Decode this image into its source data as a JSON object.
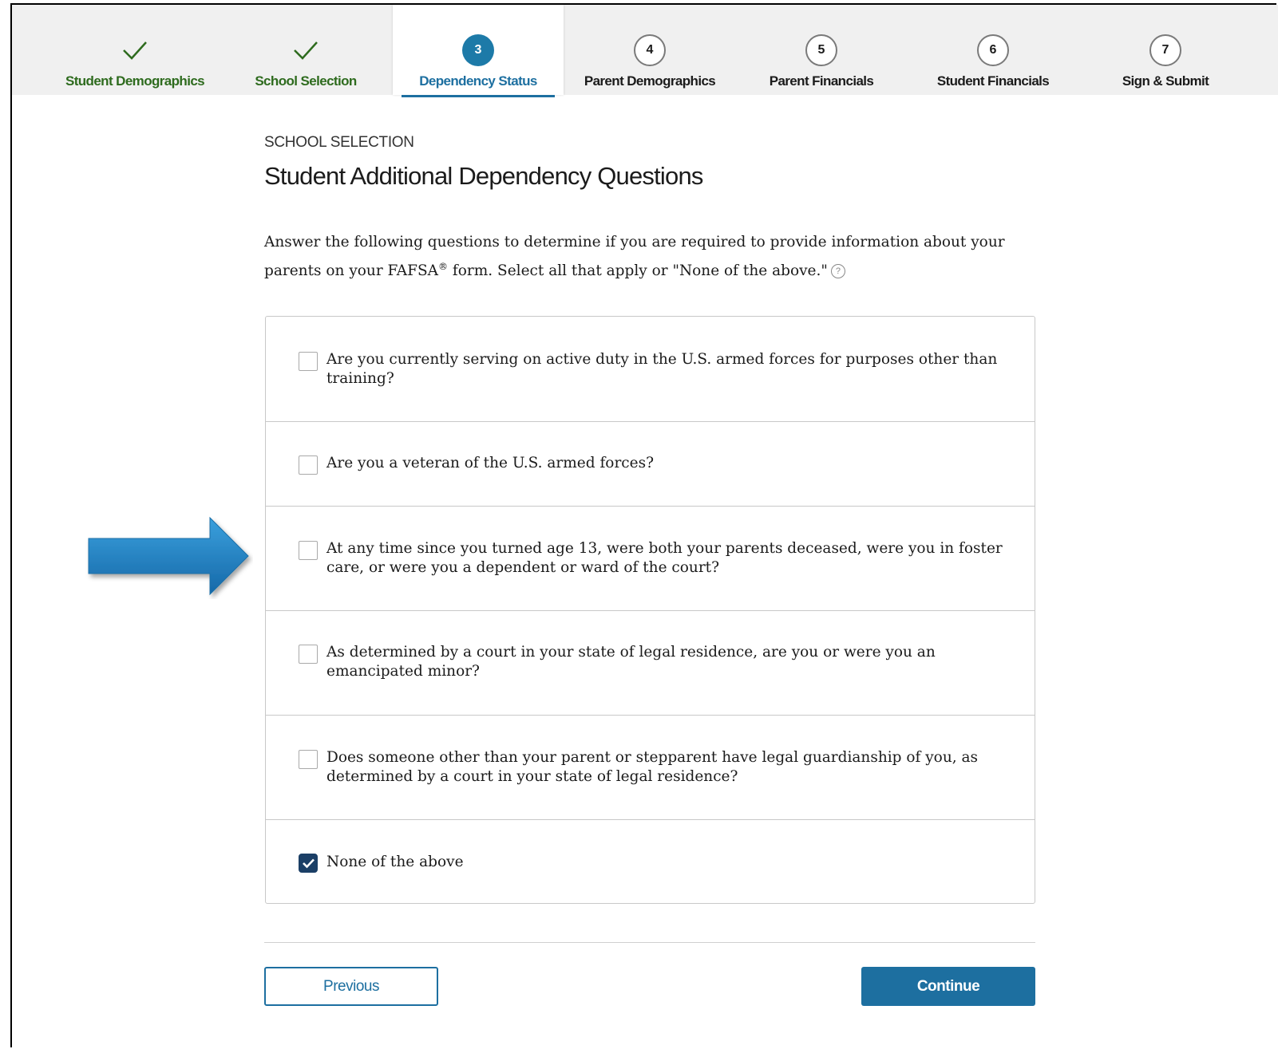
{
  "stepper": {
    "steps": [
      {
        "label": "Student Demographics",
        "status": "complete",
        "icon": "checkmark-icon"
      },
      {
        "label": "School Selection",
        "status": "complete",
        "icon": "checkmark-icon"
      },
      {
        "label": "Dependency Status",
        "status": "current",
        "number": "3"
      },
      {
        "label": "Parent Demographics",
        "status": "upcoming",
        "number": "4"
      },
      {
        "label": "Parent Financials",
        "status": "upcoming",
        "number": "5"
      },
      {
        "label": "Student Financials",
        "status": "upcoming",
        "number": "6"
      },
      {
        "label": "Sign & Submit",
        "status": "upcoming",
        "number": "7"
      }
    ]
  },
  "main": {
    "eyebrow": "SCHOOL SELECTION",
    "title": "Student Additional Dependency Questions",
    "intro_part1": "Answer the following questions to determine if you are required to provide information about your parents on your FAFSA",
    "intro_reg": "®",
    "intro_part2": " form. Select all that apply or \"None of the above.\"",
    "help_icon": "?"
  },
  "options": [
    {
      "text": "Are you currently serving on active duty in the U.S. armed forces for purposes other than training?",
      "checked": false
    },
    {
      "text": "Are you a veteran of the U.S. armed forces?",
      "checked": false
    },
    {
      "text": "At any time since you turned age 13, were both your parents deceased, were you in foster care, or were you a dependent or ward of the court?",
      "checked": false
    },
    {
      "text": "As determined by a court in your state of legal residence, are you or were you an emancipated minor?",
      "checked": false
    },
    {
      "text": "Does someone other than your parent or stepparent have legal guardianship of you, as determined by a court in your state of legal residence?",
      "checked": false
    },
    {
      "text": "None of the above",
      "checked": true
    }
  ],
  "buttons": {
    "previous": "Previous",
    "continue": "Continue"
  },
  "colors": {
    "accent": "#1d6fa0",
    "complete": "#2e6b1e",
    "arrow": "#1f80c0"
  }
}
